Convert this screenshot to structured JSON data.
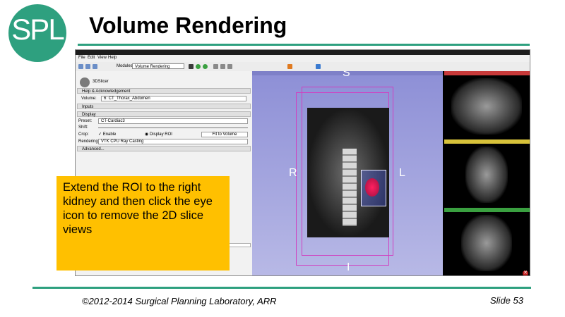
{
  "slide": {
    "logo_text": "SPL",
    "title": "Volume Rendering",
    "footer_left": "©2012-2014 Surgical Planning Laboratory, ARR",
    "footer_right": "Slide 53",
    "callout": "Extend the ROI to the right kidney and then click the eye icon to remove the 2D slice views",
    "colors": {
      "accent": "#2ea07f",
      "callout_bg": "#ffc000"
    }
  },
  "app": {
    "menu": [
      "File",
      "Edit",
      "View",
      "Help"
    ],
    "modules_label": "Modules:",
    "module_selected": "Volume Rendering",
    "panel": {
      "slicer_label": "3DSlicer",
      "help_section": "Help & Acknowledgement",
      "volume_label": "Volume:",
      "volume_value": "6: CT_Thorax_Abdomen",
      "inputs_section": "Inputs",
      "display_section": "Display",
      "preset_label": "Preset:",
      "preset_value": "CT-Cardiac3",
      "shift_label": "Shift:",
      "crop_label": "Crop:",
      "enable_label": "Enable",
      "display_roi_label": "Display ROI",
      "fit_to_volume_label": "Fit to Volume",
      "rendering_label": "Rendering:",
      "rendering_value": "VTK CPU Ray Casting",
      "advanced_section": "Advanced..."
    },
    "view3d": {
      "top": "S",
      "left": "R",
      "right": "L",
      "bottom": "I"
    },
    "slice_colors": [
      "#c83a3a",
      "#d8c23a",
      "#3aa040"
    ]
  }
}
